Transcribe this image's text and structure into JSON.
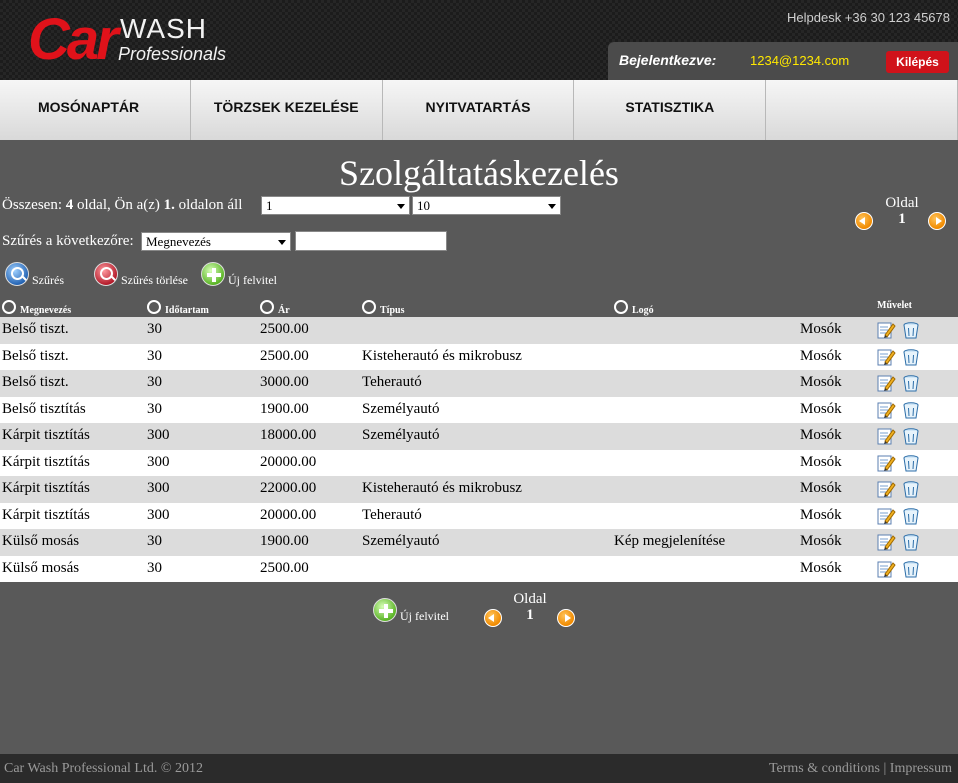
{
  "header": {
    "logo_car": "Car",
    "logo_wash": "WASH",
    "logo_professionals": "Professionals",
    "helpdesk": "Helpdesk +36 30 123 45678",
    "login_label": "Bejelentkezve:",
    "login_email": "1234@1234.com",
    "logout_label": "Kilépés"
  },
  "nav": {
    "items": [
      "MOSÓNAPTÁR",
      "TÖRZSEK KEZELÉSE",
      "NYITVATARTÁS",
      "STATISZTIKA",
      ""
    ]
  },
  "page": {
    "title": "Szolgáltatáskezelés",
    "summary_prefix": "Összesen: ",
    "total_pages": "4",
    "summary_mid": " oldal, Ön a(z) ",
    "current_page": "1.",
    "summary_suffix": " oldalon áll",
    "page_select_value": "1",
    "per_page_select_value": "10",
    "oldal_label": "Oldal",
    "oldal_number": "1"
  },
  "filter": {
    "label": "Szűrés a következőre:",
    "field_select_value": "Megnevezés",
    "text_value": "",
    "search_label": "Szűrés",
    "clear_label": "Szűrés törlése",
    "new_label": "Új felvitel"
  },
  "columns": {
    "name": "Megnevezés",
    "duration": "Időtartam",
    "price": "Ár",
    "type": "Típus",
    "logo": "Logó",
    "action": "Művelet"
  },
  "rows": [
    {
      "name": "Belső tiszt.",
      "duration": "30",
      "price": "2500.00",
      "type": "",
      "logo": "",
      "group": "Mosók"
    },
    {
      "name": "Belső tiszt.",
      "duration": "30",
      "price": "2500.00",
      "type": "Kisteherautó és mikrobusz",
      "logo": "",
      "group": "Mosók"
    },
    {
      "name": "Belső tiszt.",
      "duration": "30",
      "price": "3000.00",
      "type": "Teherautó",
      "logo": "",
      "group": "Mosók"
    },
    {
      "name": "Belső tisztítás",
      "duration": "30",
      "price": "1900.00",
      "type": "Személyautó",
      "logo": "",
      "group": "Mosók"
    },
    {
      "name": "Kárpit tisztítás",
      "duration": "300",
      "price": "18000.00",
      "type": "Személyautó",
      "logo": "",
      "group": "Mosók"
    },
    {
      "name": "Kárpit tisztítás",
      "duration": "300",
      "price": "20000.00",
      "type": "",
      "logo": "",
      "group": "Mosók"
    },
    {
      "name": "Kárpit tisztítás",
      "duration": "300",
      "price": "22000.00",
      "type": "Kisteherautó és mikrobusz",
      "logo": "",
      "group": "Mosók"
    },
    {
      "name": "Kárpit tisztítás",
      "duration": "300",
      "price": "20000.00",
      "type": "Teherautó",
      "logo": "",
      "group": "Mosók"
    },
    {
      "name": "Külső mosás",
      "duration": "30",
      "price": "1900.00",
      "type": "Személyautó",
      "logo": "Kép megjelenítése",
      "group": "Mosók"
    },
    {
      "name": "Külső mosás",
      "duration": "30",
      "price": "2500.00",
      "type": "",
      "logo": "",
      "group": "Mosók"
    }
  ],
  "bottom": {
    "new_label": "Új felvitel",
    "oldal_label": "Oldal",
    "oldal_number": "1"
  },
  "footer": {
    "copyright": "Car Wash Professional Ltd. © 2012",
    "terms": "Terms & conditions",
    "separator": "|",
    "impressum": "Impressum"
  },
  "colors": {
    "brand_red": "#e0121a",
    "email_yellow": "#ffe800",
    "content_bg": "#595959",
    "row_alt": "#dcdcdc"
  }
}
